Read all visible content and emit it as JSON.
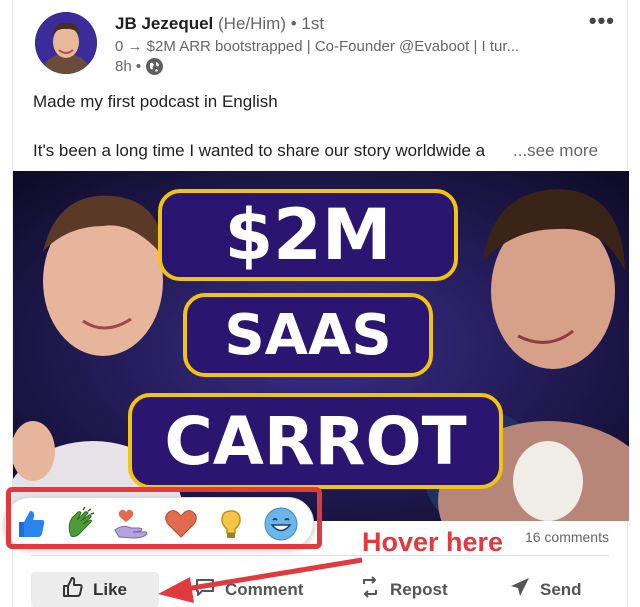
{
  "author": {
    "name": "JB Jezequel",
    "pronouns": "(He/Him)",
    "degree": "• 1st",
    "headline": "0 → $2M ARR bootstrapped | Co-Founder @Evaboot | I tur...",
    "time": "8h •",
    "visibility_icon": "globe-icon"
  },
  "post": {
    "line1": "Made my first podcast in English",
    "line2": "It's been a long time I wanted to share our story worldwide a",
    "see_more": "...see more"
  },
  "media": {
    "title_top": "$2M",
    "title_mid": "SAAS",
    "title_bottom": "CARROT"
  },
  "reactions": [
    {
      "name": "like",
      "icon": "thumbs-up-icon"
    },
    {
      "name": "celebrate",
      "icon": "clapping-hands-icon"
    },
    {
      "name": "support",
      "icon": "heart-in-hand-icon"
    },
    {
      "name": "love",
      "icon": "heart-icon"
    },
    {
      "name": "insightful",
      "icon": "lightbulb-icon"
    },
    {
      "name": "funny",
      "icon": "laughing-face-icon"
    }
  ],
  "social": {
    "comments": "16 comments"
  },
  "actions": {
    "like": "Like",
    "comment": "Comment",
    "repost": "Repost",
    "send": "Send"
  },
  "annotation": {
    "hover_label": "Hover here",
    "color": "#e03a3e"
  },
  "colors": {
    "pill_border": "#f1c40f",
    "pill_fill": "#2a1670",
    "media_bg": "#15123a"
  }
}
